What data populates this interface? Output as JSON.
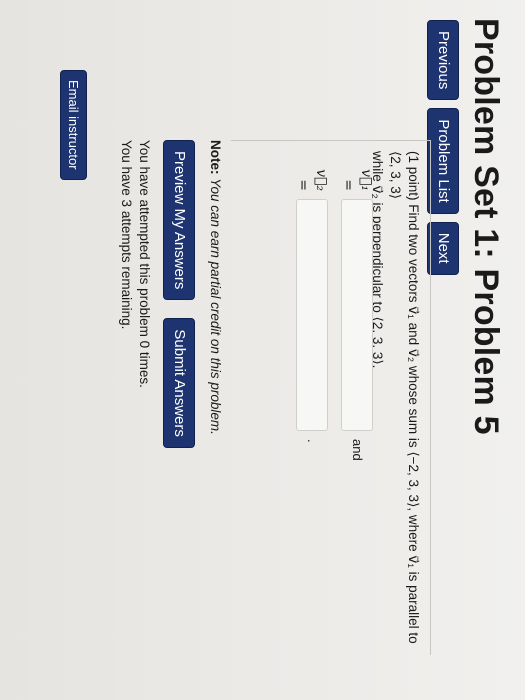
{
  "page": {
    "title": "Problem Set 1: Problem 5"
  },
  "nav": {
    "previous": "Previous",
    "problem_list": "Problem List",
    "next": "Next"
  },
  "problem": {
    "text_line1": "(1 point) Find two vectors v⃗₁ and v⃗₂ whose sum is ⟨−2, 3, 3⟩, where v⃗₁ is parallel to ⟨2, 3, 3⟩",
    "text_line2": "while v⃗₂ is perpendicular to ⟨2, 3, 3⟩.",
    "v1_label": "v⃗₁ =",
    "v2_label": "v⃗₂ =",
    "v1_value": "",
    "v2_value": "",
    "after_v1": "and",
    "after_v2": "."
  },
  "note": {
    "label": "Note:",
    "text": "You can earn partial credit on this problem."
  },
  "actions": {
    "preview": "Preview My Answers",
    "submit": "Submit Answers"
  },
  "status": {
    "attempted": "You have attempted this problem 0 times.",
    "remaining": "You have 3 attempts remaining."
  },
  "footer": {
    "email": "Email instructor"
  }
}
